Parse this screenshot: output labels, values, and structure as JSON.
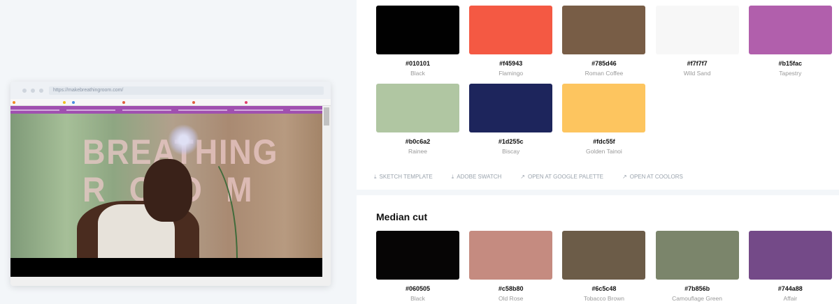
{
  "browser": {
    "url": "https://makebreathingroom.com/",
    "hero_text_line1": "BREATHING",
    "hero_text_line2": "ROOM"
  },
  "palette1": [
    {
      "hex": "#010101",
      "name": "Black"
    },
    {
      "hex": "#f45943",
      "name": "Flamingo"
    },
    {
      "hex": "#785d46",
      "name": "Roman Coffee"
    },
    {
      "hex": "#f7f7f7",
      "name": "Wild Sand"
    },
    {
      "hex": "#b15fac",
      "name": "Tapestry"
    },
    {
      "hex": "#b0c6a2",
      "name": "Rainee"
    },
    {
      "hex": "#1d255c",
      "name": "Biscay"
    },
    {
      "hex": "#fdc55f",
      "name": "Golden Tainoi"
    }
  ],
  "actions": [
    {
      "label": "SKETCH TEMPLATE",
      "icon": "download-icon"
    },
    {
      "label": "ADOBE SWATCH",
      "icon": "download-icon"
    },
    {
      "label": "OPEN AT GOOGLE PALETTE",
      "icon": "external-link-icon"
    },
    {
      "label": "OPEN AT COOLORS",
      "icon": "external-link-icon"
    }
  ],
  "median": {
    "title": "Median cut",
    "colors": [
      {
        "hex": "#060505",
        "name": "Black"
      },
      {
        "hex": "#c58b80",
        "name": "Old Rose"
      },
      {
        "hex": "#6c5c48",
        "name": "Tobacco Brown"
      },
      {
        "hex": "#7b856b",
        "name": "Camouflage Green"
      },
      {
        "hex": "#744a88",
        "name": "Affair"
      }
    ]
  }
}
